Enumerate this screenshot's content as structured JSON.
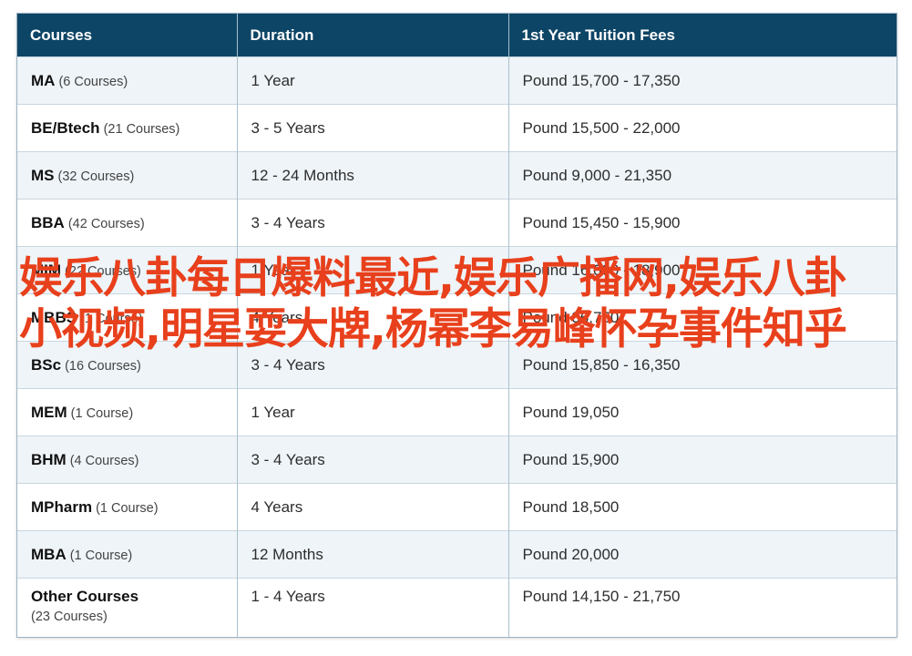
{
  "table": {
    "headers": [
      "Courses",
      "Duration",
      "1st Year Tuition Fees"
    ],
    "rows": [
      {
        "course": "MA",
        "count": "(6 Courses)",
        "duration": "1 Year",
        "fees": "Pound 15,700 - 17,350"
      },
      {
        "course": "BE/Btech",
        "count": "(21 Courses)",
        "duration": "3 - 5 Years",
        "fees": "Pound 15,500 - 22,000"
      },
      {
        "course": "MS",
        "count": "(32 Courses)",
        "duration": "12 - 24 Months",
        "fees": "Pound 9,000 - 21,350"
      },
      {
        "course": "BBA",
        "count": "(42 Courses)",
        "duration": "3 - 4 Years",
        "fees": "Pound 15,450 - 15,900"
      },
      {
        "course": "MIM",
        "count": "(22 Courses)",
        "duration": "1 Year",
        "fees": "Pound 16,000 - 18,900"
      },
      {
        "course": "MBBS",
        "count": "(1 Course)",
        "duration": "4 Years",
        "fees": "Pound 36,750"
      },
      {
        "course": "BSc",
        "count": "(16 Courses)",
        "duration": "3 - 4 Years",
        "fees": "Pound 15,850 - 16,350"
      },
      {
        "course": "MEM",
        "count": "(1 Course)",
        "duration": "1 Year",
        "fees": "Pound 19,050"
      },
      {
        "course": "BHM",
        "count": "(4 Courses)",
        "duration": "3 - 4 Years",
        "fees": "Pound 15,900"
      },
      {
        "course": "MPharm",
        "count": "(1 Course)",
        "duration": "4 Years",
        "fees": "Pound 18,500"
      },
      {
        "course": "MBA",
        "count": "(1 Course)",
        "duration": "12 Months",
        "fees": "Pound 20,000"
      },
      {
        "course": "Other Courses",
        "count": "(23 Courses)",
        "duration": "1 - 4 Years",
        "fees": "Pound 14,150 - 21,750"
      }
    ]
  },
  "overlay_text": "娱乐八卦每日爆料最近,娱乐广播网,娱乐八卦小视频,明星耍大牌,杨幂李易峰怀孕事件知乎",
  "colors": {
    "header_bg": "#0d4566",
    "row_alt_bg": "#eef4f8",
    "overlay_text": "#e8401c"
  }
}
